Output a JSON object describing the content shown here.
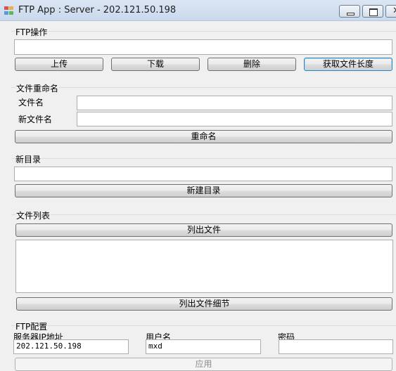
{
  "window": {
    "title": "FTP App : Server - 202.121.50.198"
  },
  "ftp_ops": {
    "group_title": "FTP操作",
    "path_value": "",
    "upload_label": "上传",
    "download_label": "下载",
    "delete_label": "删除",
    "get_length_label": "获取文件长度"
  },
  "rename": {
    "group_title": "文件重命名",
    "filename_label": "文件名",
    "filename_value": "",
    "new_filename_label": "新文件名",
    "new_filename_value": "",
    "rename_label": "重命名"
  },
  "new_dir": {
    "group_title": "新目录",
    "dir_value": "",
    "create_label": "新建目录"
  },
  "file_list": {
    "group_title": "文件列表",
    "list_files_label": "列出文件",
    "list_details_label": "列出文件细节",
    "items": []
  },
  "ftp_config": {
    "group_title": "FTP配置",
    "server_ip_label": "服务器IP地址",
    "server_ip_value": "202.121.50.198",
    "username_label": "用户名",
    "username_value": "mxd",
    "password_label": "密码",
    "password_value": "",
    "apply_label": "应用"
  },
  "icons": {
    "app": "app-window-icon",
    "minimize": "minimize-icon",
    "maximize": "maximize-icon",
    "close": "close-icon"
  }
}
